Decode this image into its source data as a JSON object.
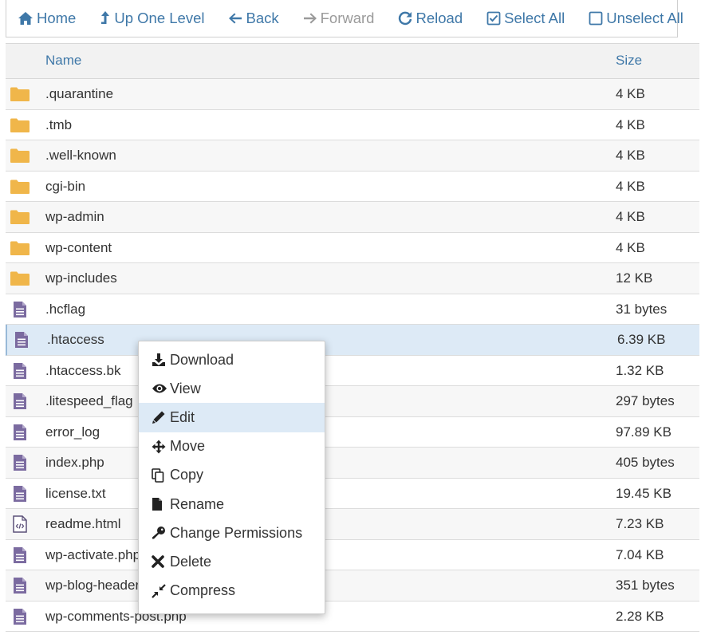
{
  "toolbar": {
    "home": "Home",
    "up": "Up One Level",
    "back": "Back",
    "forward": "Forward",
    "reload": "Reload",
    "select_all": "Select All",
    "unselect_all": "Unselect All"
  },
  "table": {
    "col_name": "Name",
    "col_size": "Size",
    "rows": [
      {
        "name": ".quarantine",
        "size": "4 KB",
        "icon": "folder-icon"
      },
      {
        "name": ".tmb",
        "size": "4 KB",
        "icon": "folder-icon"
      },
      {
        "name": ".well-known",
        "size": "4 KB",
        "icon": "folder-icon"
      },
      {
        "name": "cgi-bin",
        "size": "4 KB",
        "icon": "folder-icon"
      },
      {
        "name": "wp-admin",
        "size": "4 KB",
        "icon": "folder-icon"
      },
      {
        "name": "wp-content",
        "size": "4 KB",
        "icon": "folder-icon"
      },
      {
        "name": "wp-includes",
        "size": "12 KB",
        "icon": "folder-icon"
      },
      {
        "name": ".hcflag",
        "size": "31 bytes",
        "icon": "text-file-icon"
      },
      {
        "name": ".htaccess",
        "size": "6.39 KB",
        "icon": "text-file-icon"
      },
      {
        "name": ".htaccess.bk",
        "size": "1.32 KB",
        "icon": "text-file-icon"
      },
      {
        "name": ".litespeed_flag",
        "size": "297 bytes",
        "icon": "text-file-icon"
      },
      {
        "name": "error_log",
        "size": "97.89 KB",
        "icon": "text-file-icon"
      },
      {
        "name": "index.php",
        "size": "405 bytes",
        "icon": "text-file-icon"
      },
      {
        "name": "license.txt",
        "size": "19.45 KB",
        "icon": "text-file-icon"
      },
      {
        "name": "readme.html",
        "size": "7.23 KB",
        "icon": "code-file-icon"
      },
      {
        "name": "wp-activate.php",
        "size": "7.04 KB",
        "icon": "text-file-icon"
      },
      {
        "name": "wp-blog-header.php",
        "size": "351 bytes",
        "icon": "text-file-icon"
      },
      {
        "name": "wp-comments-post.php",
        "size": "2.28 KB",
        "icon": "text-file-icon"
      }
    ],
    "selected_row": ".htaccess"
  },
  "context_menu": {
    "items": [
      {
        "label": "Download",
        "icon": "download-icon"
      },
      {
        "label": "View",
        "icon": "eye-icon"
      },
      {
        "label": "Edit",
        "icon": "pencil-icon"
      },
      {
        "label": "Move",
        "icon": "move-arrows-icon"
      },
      {
        "label": "Copy",
        "icon": "copy-icon"
      },
      {
        "label": "Rename",
        "icon": "file-icon"
      },
      {
        "label": "Change Permissions",
        "icon": "key-icon"
      },
      {
        "label": "Delete",
        "icon": "x-icon"
      },
      {
        "label": "Compress",
        "icon": "compress-icon"
      }
    ],
    "highlighted": "Edit"
  },
  "colors": {
    "link_blue": "#3f78a8",
    "folder": "#f0b64a",
    "file": "#7b6ba0",
    "selected_bg": "#ddeaf6"
  }
}
